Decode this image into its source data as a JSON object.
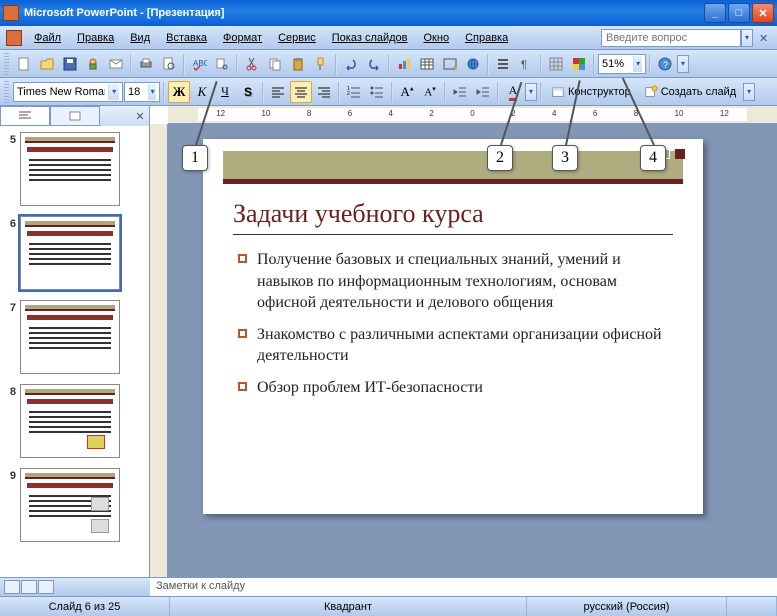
{
  "app": {
    "title": "Microsoft PowerPoint - [Презентация]"
  },
  "menu": {
    "file": "Файл",
    "edit": "Правка",
    "view": "Вид",
    "insert": "Вставка",
    "format": "Формат",
    "service": "Сервис",
    "slideshow": "Показ слайдов",
    "window": "Окно",
    "help": "Справка",
    "ask_placeholder": "Введите вопрос"
  },
  "toolbar": {
    "font": "Times New Roman",
    "size": "18",
    "zoom": "51%",
    "designer": "Конструктор",
    "newslide": "Создать слайд"
  },
  "ruler_marks": [
    "12",
    "10",
    "8",
    "6",
    "4",
    "2",
    "0",
    "2",
    "4",
    "6",
    "8",
    "10",
    "12"
  ],
  "thumbs": [
    {
      "num": "5"
    },
    {
      "num": "6",
      "selected": true
    },
    {
      "num": "7"
    },
    {
      "num": "8"
    },
    {
      "num": "9"
    }
  ],
  "slide": {
    "title": "Задачи учебного курса",
    "bullets": [
      "Получение базовых и специальных знаний, умений и навыков по информационным технологиям, основам офисной деятельности и делового общения",
      "Знакомство с различными аспектами организации офисной деятельности",
      "Обзор проблем ИТ-безопасности"
    ]
  },
  "notes": "Заметки к слайду",
  "status": {
    "slide": "Слайд 6 из 25",
    "layout": "Квадрант",
    "lang": "русский (Россия)"
  },
  "callouts": {
    "c1": "1",
    "c2": "2",
    "c3": "3",
    "c4": "4"
  }
}
